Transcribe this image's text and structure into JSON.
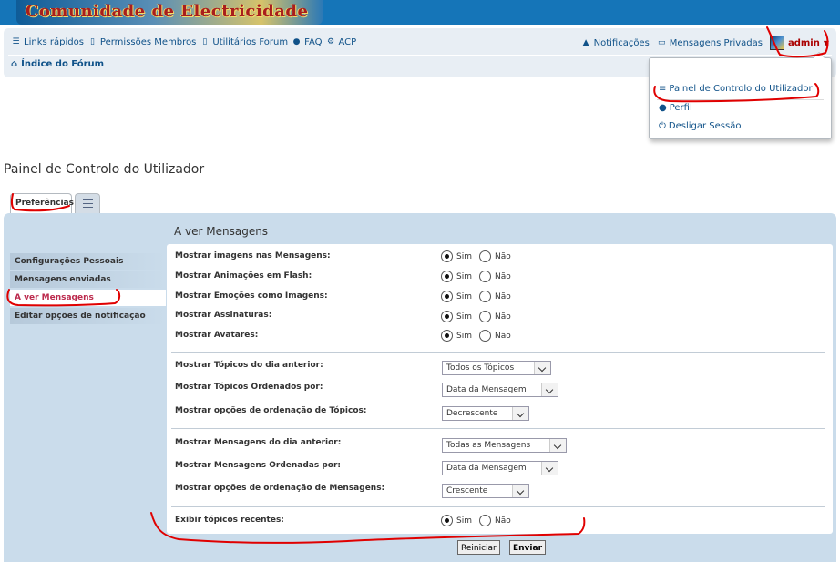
{
  "header": {
    "logo_text": "Comunidade de Electricidade"
  },
  "navbar": {
    "links": [
      {
        "icon": "bars-icon",
        "label": "Links rápidos"
      },
      {
        "icon": "file-icon",
        "label": "Permissões Membros"
      },
      {
        "icon": "file-icon",
        "label": "Utilitários Forum"
      },
      {
        "icon": "question-icon",
        "label": "FAQ"
      },
      {
        "icon": "cogs-icon",
        "label": "ACP"
      }
    ],
    "notifications_label": "Notificações",
    "private_messages_label": "Mensagens Privadas",
    "username": "admin",
    "breadcrumb_label": "Índice do Fórum"
  },
  "user_menu": {
    "items": [
      {
        "icon": "sliders-icon",
        "label": "Painel de Controlo do Utilizador"
      },
      {
        "icon": "user-icon",
        "label": "Perfil"
      },
      {
        "icon": "power-icon",
        "label": "Desligar Sessão"
      }
    ]
  },
  "page_title": "Painel de Controlo do Utilizador",
  "tabs": {
    "active_label": "Preferências"
  },
  "side_menu": {
    "items": [
      {
        "label": "Configurações Pessoais",
        "active": false
      },
      {
        "label": "Mensagens enviadas",
        "active": false
      },
      {
        "label": "A ver Mensagens",
        "active": true
      },
      {
        "label": "Editar opções de notificação",
        "active": false
      }
    ]
  },
  "section_title": "A ver Mensagens",
  "radio_options": {
    "yes": "Sim",
    "no": "Não"
  },
  "radio_rows": [
    {
      "label": "Mostrar imagens nas Mensagens:",
      "value": "Sim"
    },
    {
      "label": "Mostrar Animações em Flash:",
      "value": "Sim"
    },
    {
      "label": "Mostrar Emoções como Imagens:",
      "value": "Sim"
    },
    {
      "label": "Mostrar Assinaturas:",
      "value": "Sim"
    },
    {
      "label": "Mostrar Avatares:",
      "value": "Sim"
    }
  ],
  "topic_rows": [
    {
      "label": "Mostrar Tópicos do dia anterior:",
      "value": "Todos os Tópicos"
    },
    {
      "label": "Mostrar Tópicos Ordenados por:",
      "value": "Data da Mensagem"
    },
    {
      "label": "Mostrar opções de ordenação de Tópicos:",
      "value": "Decrescente"
    }
  ],
  "post_rows": [
    {
      "label": "Mostrar Mensagens do dia anterior:",
      "value": "Todas as Mensagens"
    },
    {
      "label": "Mostrar Mensagens Ordenadas por:",
      "value": "Data da Mensagem"
    },
    {
      "label": "Mostrar opções de ordenação de Mensagens:",
      "value": "Crescente"
    }
  ],
  "recent_row": {
    "label": "Exibir tópicos recentes:",
    "value": "Sim"
  },
  "buttons": {
    "reset": "Reiniciar",
    "submit": "Enviar"
  },
  "colors": {
    "header": "#1575b8",
    "link": "#105289",
    "panel": "#cadceb",
    "active_menu": "#bc2a4d",
    "annotation": "#e00000"
  }
}
